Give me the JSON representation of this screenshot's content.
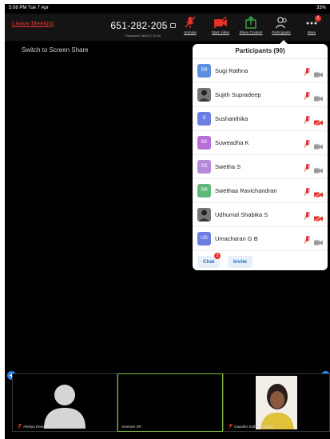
{
  "status_bar": {
    "time": "5:08 PM  Tue 7 Apr",
    "right": "33%"
  },
  "meeting": {
    "leave_label": "Leave Meeting",
    "meeting_id": "651-282-205",
    "password_line": "Password: 583471 10:44"
  },
  "toolbar": {
    "unmute": "Unmute",
    "start_video": "Start Video",
    "share_content": "Share Content",
    "participants": "Participants",
    "more": "More",
    "more_badge": "1"
  },
  "main": {
    "switch_share": "Switch to Screen Share"
  },
  "participants_panel": {
    "title": "Participants (90)",
    "items": [
      {
        "initials": "SR",
        "name": "Sugi Rathna",
        "color": "#5b8fe0",
        "photo": false,
        "video_muted": false
      },
      {
        "initials": "",
        "name": "Sujith Supradeep",
        "color": "#6a5a4a",
        "photo": true,
        "video_muted": false
      },
      {
        "initials": "S",
        "name": "Sushanthika",
        "color": "#6c7ee0",
        "photo": false,
        "video_muted": true
      },
      {
        "initials": "SK",
        "name": "Suweadha K",
        "color": "#b86fd6",
        "photo": false,
        "video_muted": false
      },
      {
        "initials": "SS",
        "name": "Swetha S",
        "color": "#b48ad8",
        "photo": false,
        "video_muted": false
      },
      {
        "initials": "SR",
        "name": "Swethaa Ravichandran",
        "color": "#5fb87a",
        "photo": false,
        "video_muted": true
      },
      {
        "initials": "",
        "name": "Udhumal Shabika S",
        "color": "#4a4a4a",
        "photo": true,
        "video_muted": true
      },
      {
        "initials": "UG",
        "name": "Umacharan G B",
        "color": "#6c7ee0",
        "photo": false,
        "video_muted": false
      }
    ],
    "chat_label": "Chat",
    "chat_badge": "3",
    "invite_label": "Invite"
  },
  "thumbnails": [
    {
      "name": "Akshya Ramanujam"
    },
    {
      "name": "Sreeram SR"
    },
    {
      "name": "Gayathri Sathiyamoorthy"
    }
  ],
  "colors": {
    "accent": "#1a70c8",
    "danger": "#e5322b",
    "active_speaker": "#7fbf3c"
  }
}
